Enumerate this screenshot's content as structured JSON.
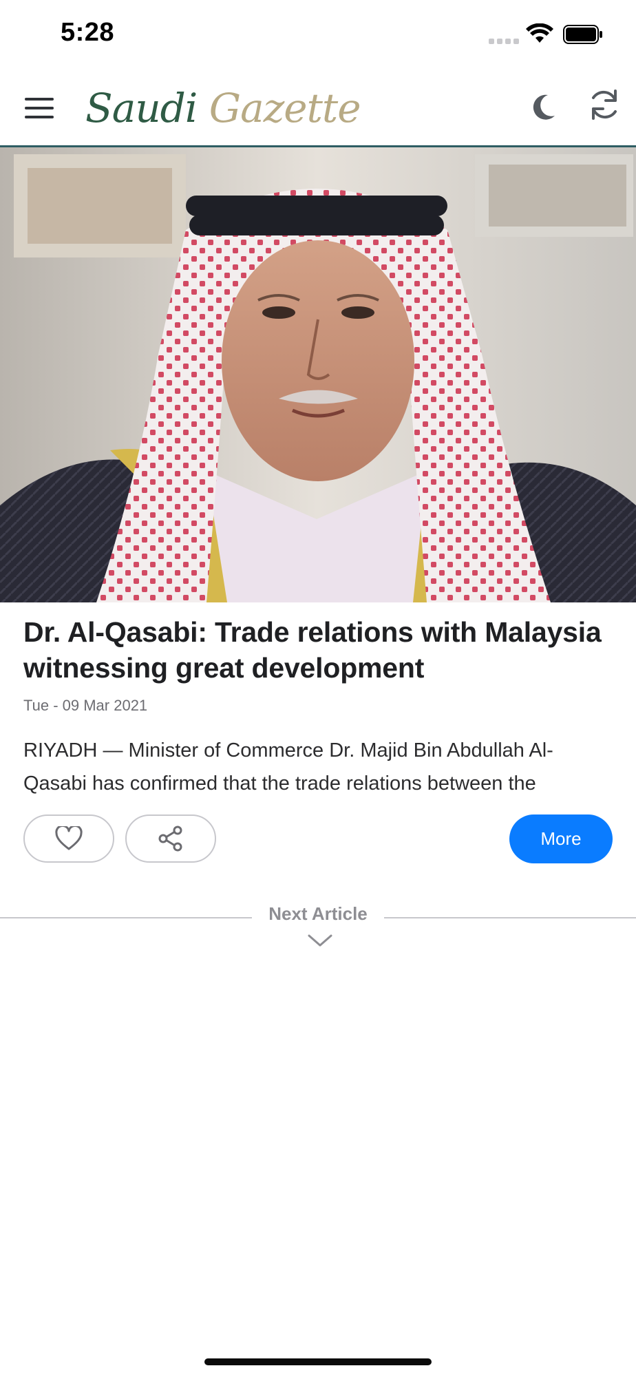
{
  "status_bar": {
    "time": "5:28"
  },
  "header": {
    "brand_first": "Saudi",
    "brand_second": "Gazette",
    "icons": {
      "menu": "hamburger-menu-icon",
      "dark_mode": "moon-icon",
      "refresh": "refresh-icon"
    },
    "colors": {
      "brand_green": "#2f5b45",
      "brand_gold": "#b8aa84",
      "header_border": "#2e5d63"
    }
  },
  "article": {
    "image_alt": "Portrait of Dr. Majid Al-Qasabi",
    "title": "Dr. Al-Qasabi: Trade relations with Malaysia witnessing great development",
    "date": "Tue - 09 Mar 2021",
    "excerpt": "RIYADH — Minister of Commerce Dr. Majid Bin Abdullah Al-Qasabi has confirmed that the trade relations between the"
  },
  "actions": {
    "like_icon": "heart-icon",
    "share_icon": "share-icon",
    "more_label": "More",
    "accent_color": "#0a7cff"
  },
  "next": {
    "label": "Next Article",
    "icon": "chevron-down-icon"
  }
}
